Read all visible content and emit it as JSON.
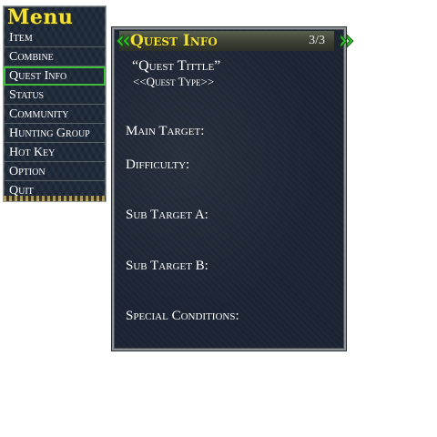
{
  "menu": {
    "title": "Menu",
    "selected_index": 2,
    "items": [
      {
        "label": "Item"
      },
      {
        "label": "Combine"
      },
      {
        "label": "Quest Info"
      },
      {
        "label": "Status"
      },
      {
        "label": "Community"
      },
      {
        "label": "Hunting Group"
      },
      {
        "label": "Hot Key"
      },
      {
        "label": "Option"
      },
      {
        "label": "Quit"
      }
    ]
  },
  "quest": {
    "header_title": "Quest Info",
    "page_indicator": "3/3",
    "name": "“Quest Tittle”",
    "type": "<<Quest Type>>",
    "fields": {
      "main_target": "Main Target:",
      "difficulty": "Difficulty:",
      "sub_target_a": "Sub Target A:",
      "sub_target_b": "Sub Target B:",
      "special_conditions": "Special Conditions:"
    }
  },
  "colors": {
    "title_yellow": "#f2e131",
    "selection_green": "#3fbe3a",
    "arrow_green": "#2fbf2a",
    "panel_bg": "#1c2433"
  },
  "icons": {
    "prev": "double-chevron-left-icon",
    "next": "double-chevron-right-icon"
  }
}
